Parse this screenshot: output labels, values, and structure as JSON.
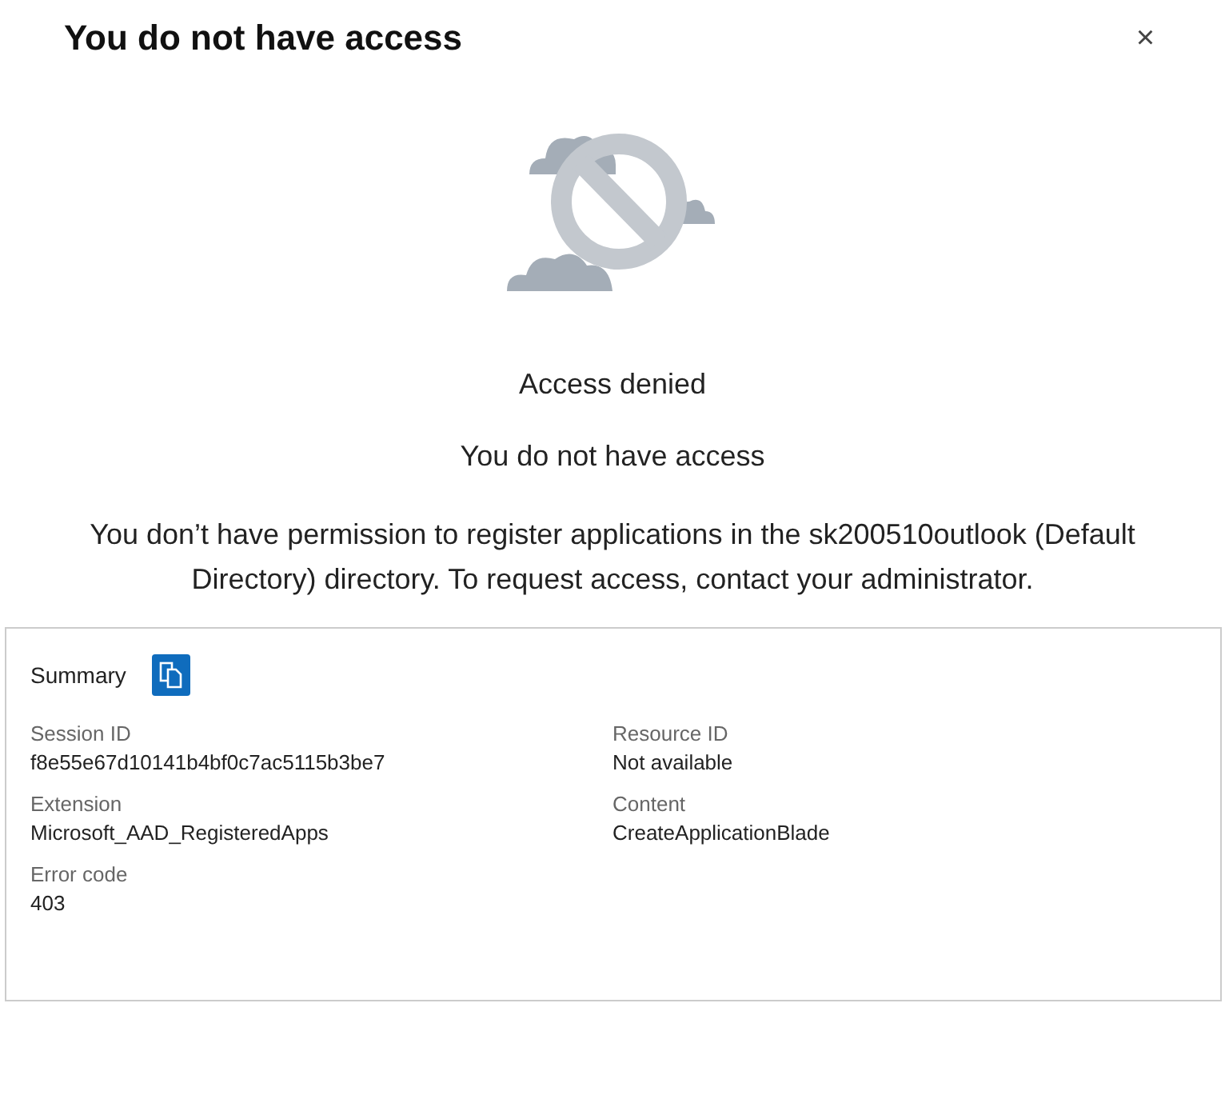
{
  "dialog": {
    "title": "You do not have access",
    "close": "×"
  },
  "message": {
    "heading": "Access denied",
    "subheading": "You do not have access",
    "body": "You don’t have permission to register applications in the sk200510outlook (Default Directory) directory. To request access, contact your administrator."
  },
  "summary": {
    "title": "Summary",
    "fields": [
      {
        "label": "Session ID",
        "value": "f8e55e67d10141b4bf0c7ac5115b3be7"
      },
      {
        "label": "Resource ID",
        "value": "Not available"
      },
      {
        "label": "Extension",
        "value": "Microsoft_AAD_RegisteredApps"
      },
      {
        "label": "Content",
        "value": "CreateApplicationBlade"
      },
      {
        "label": "Error code",
        "value": "403"
      }
    ]
  }
}
